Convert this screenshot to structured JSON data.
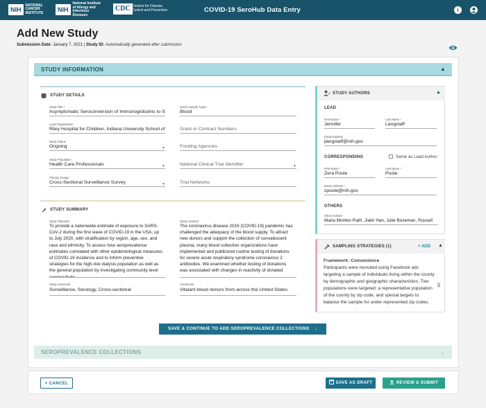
{
  "header": {
    "logos": [
      {
        "abbr": "NIH",
        "text": "NATIONAL CANCER INSTITUTE"
      },
      {
        "abbr": "NIH",
        "text": "National Institute of Allergy and Infectious Diseases"
      },
      {
        "abbr": "CDC",
        "text": "Centers for Disease Control and Prevention"
      }
    ],
    "title": "COVID-19 SeroHub Data Entry",
    "info_icon": "info-icon",
    "user_icon": "user-icon"
  },
  "page": {
    "title": "Add New Study",
    "submission_date_label": "Submission Date",
    "submission_date": ": January 7, 2021 |",
    "study_id_label": "Study ID:",
    "study_id_value": "Automatically generated after submission"
  },
  "study_info": {
    "heading": "STUDY INFORMATION",
    "details_heading": "STUDY DETAILS",
    "study_title_label": "Study Title *",
    "study_title": "Asymptomatic Seroconversion of Immunoglobulins to SA",
    "lead_org_label": "Lead Organization",
    "lead_org": "Riley Hospital for Children, Indiana University School of",
    "study_status_label": "Study Status",
    "study_status": "Ongoing",
    "study_population_label": "Study Population",
    "study_population": "Health Care Professionals",
    "primary_design_label": "Primary Design",
    "primary_design": "Cross-Sectional Surveillance Survey",
    "sample_types_label": "Study Sample Types",
    "sample_types": "Blood",
    "grant_placeholder": "Grant or Contract Numbers",
    "funding_placeholder": "Funding Agencies",
    "trial_placeholder": "National Clinical Trial Identifier",
    "trial_networks_placeholder": "Trial Networks",
    "summary_heading": "STUDY SUMMARY",
    "objective_label": "Study Objective",
    "objective": "To provide a nationwide estimate of exposure to SARS-CoV-2 during the first wave of COVID-19 in the USA, up to July 2020, with stratification by region, age, sex, and race and ethnicity. To assess how seroprevalence estimates correlated with other epidemiological measures of COVID-19 incidence and to inform preventive strategies for the high-risk dialysis population as well as the general population by investigating community level seropositivity.",
    "abstract_label": "Study Abstract",
    "abstract": "The coronavirus disease 2019 (COVID-19) pandemic has challenged the adequacy of the blood supply. To attract new donors and support the collection of convalescent plasma, many blood collection organizations have implemented and publicized routine testing of donations for severe acute respiratory syndrome coronavirus 2 antibodies. We examined whether testing of donations was associated with changes in reactivity of donated",
    "keywords_label": "Study Keywords",
    "keywords": "Surveillance, Serology, Cross-sectional",
    "comments_label": "Comments",
    "comments": "Vitalant blood donors from across the United States"
  },
  "authors": {
    "heading": "STUDY AUTHORS",
    "lead_heading": "LEAD",
    "lead_first_label": "First Name *",
    "lead_first": "Jennifer",
    "lead_last_label": "Last Name *",
    "lead_last": "Langstaff",
    "lead_email_label": "Email Address",
    "lead_email": "jlangstaff@nih.gov",
    "corr_heading": "CORRESPONDING",
    "same_as_lead": "Same as Lead Author",
    "corr_first_label": "First Name *",
    "corr_first": "Zera Poole",
    "corr_last_label": "Last Name *",
    "corr_last": "Poole",
    "corr_email_label": "Email Address *",
    "corr_email": "zpoole@nih.gov",
    "others_heading": "OTHERS",
    "other_authors_label": "Other Authors",
    "other_authors": "Maria Montez-Rath,  Jialin Han,  Julie Bozeman, Russell"
  },
  "sampling": {
    "heading": "SAMPLING STRATEGIES (1)",
    "add_label": "+ ADD",
    "framework": "Framework: Convenience",
    "text": "Participants were recruited using Facebook ads targeting a sample of individuals living within the county by demographic and geographic characteristics. Two populations were targeted: a representative population of the county by zip code, and special targets to balance the sample for under-represented zip codes."
  },
  "actions": {
    "save_continue": "SAVE & CONTINUE TO ADD SEROPREVALENCE COLLECTIONS",
    "sero_heading": "SEROPREVALENCE COLLECTIONS",
    "cancel": "CANCEL",
    "save_draft": "SAVE AS DRAFT",
    "review_submit": "REVIEW & SUBMIT"
  },
  "colors": {
    "topbar": "#18536a",
    "section_head": "#a8dadf",
    "primary_button": "#1d6f8b",
    "submit_button": "#2aa18a"
  }
}
